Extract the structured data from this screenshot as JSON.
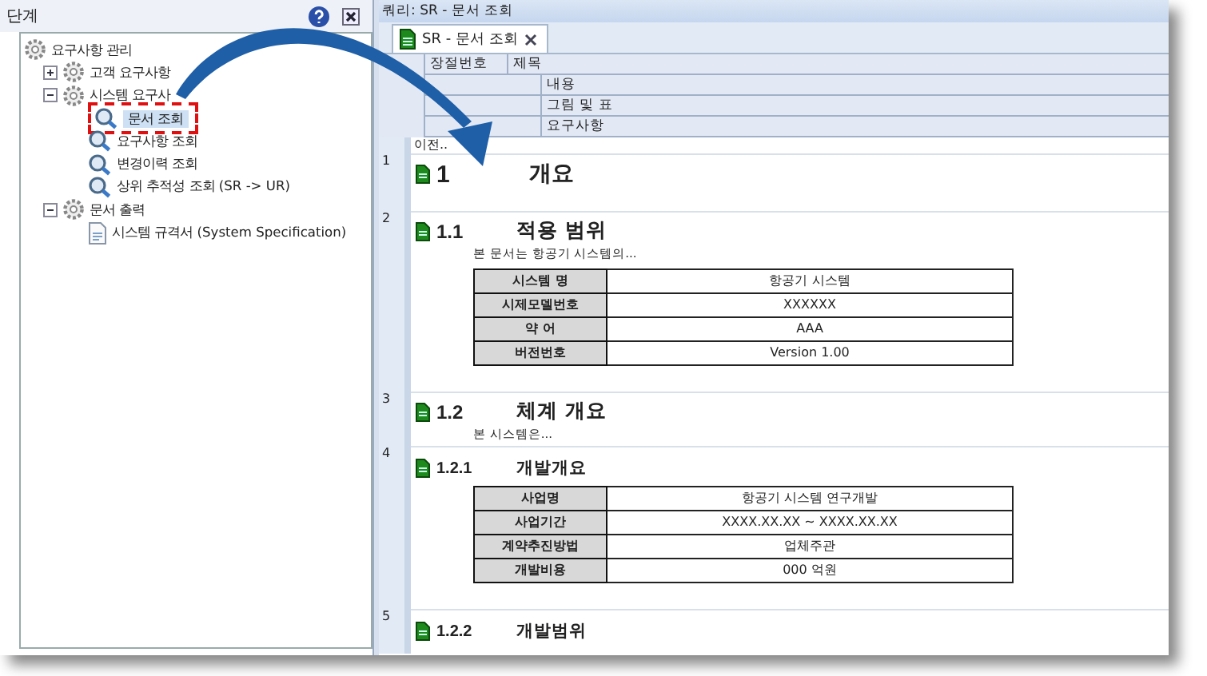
{
  "left_panel": {
    "title": "단계",
    "tree": [
      {
        "label": "요구사항 관리",
        "kind": "folder",
        "selected": false,
        "children": [
          {
            "label": "고객 요구사항",
            "kind": "folder",
            "expanded": false,
            "selected": false
          },
          {
            "label": "시스템 요구사",
            "kind": "folder",
            "expanded": true,
            "selected": false,
            "children": [
              {
                "label": "문서 조회",
                "kind": "query",
                "selected": true
              },
              {
                "label": "요구사항 조회",
                "kind": "query",
                "selected": false
              },
              {
                "label": "변경이력 조회",
                "kind": "query",
                "selected": false
              },
              {
                "label": "상위 추적성 조회 (SR -> UR)",
                "kind": "query",
                "selected": false
              }
            ]
          },
          {
            "label": "문서 출력",
            "kind": "folder",
            "expanded": true,
            "selected": false,
            "children": [
              {
                "label": "시스템 규격서 (System Specification)",
                "kind": "document",
                "selected": false
              }
            ]
          }
        ]
      }
    ]
  },
  "query_title": "쿼리: SR - 문서 조회",
  "tabs": [
    {
      "label": "SR - 문서 조회",
      "selected": true
    }
  ],
  "header": {
    "number": "장절번호",
    "title": "제목",
    "content": "내용",
    "figures": "그림 및 표",
    "requirements": "요구사항"
  },
  "previous": "이전..",
  "sections": [
    {
      "row": "1",
      "kind": "h1",
      "number": "1",
      "title": "개요"
    },
    {
      "row": "2",
      "kind": "h2",
      "number": "1.1",
      "title": "적용 범위",
      "text": "본 문서는 항공기 시스템의...",
      "table": [
        [
          "시스템 명",
          "항공기 시스템"
        ],
        [
          "시제모델번호",
          "XXXXXX"
        ],
        [
          "약    어",
          "AAA"
        ],
        [
          "버전번호",
          "Version 1.00"
        ]
      ]
    },
    {
      "row": "3",
      "kind": "h2",
      "number": "1.2",
      "title": "체계 개요",
      "text": "본 시스템은..."
    },
    {
      "row": "4",
      "kind": "h3",
      "number": "1.2.1",
      "title": "개발개요",
      "table": [
        [
          "사업명",
          "항공기 시스템 연구개발"
        ],
        [
          "사업기간",
          "XXXX.XX.XX ~ XXXX.XX.XX"
        ],
        [
          "계약추진방법",
          "업체주관"
        ],
        [
          "개발비용",
          "000 억원"
        ]
      ]
    },
    {
      "row": "5",
      "kind": "h3",
      "number": "1.2.2",
      "title": "개발범위"
    }
  ]
}
